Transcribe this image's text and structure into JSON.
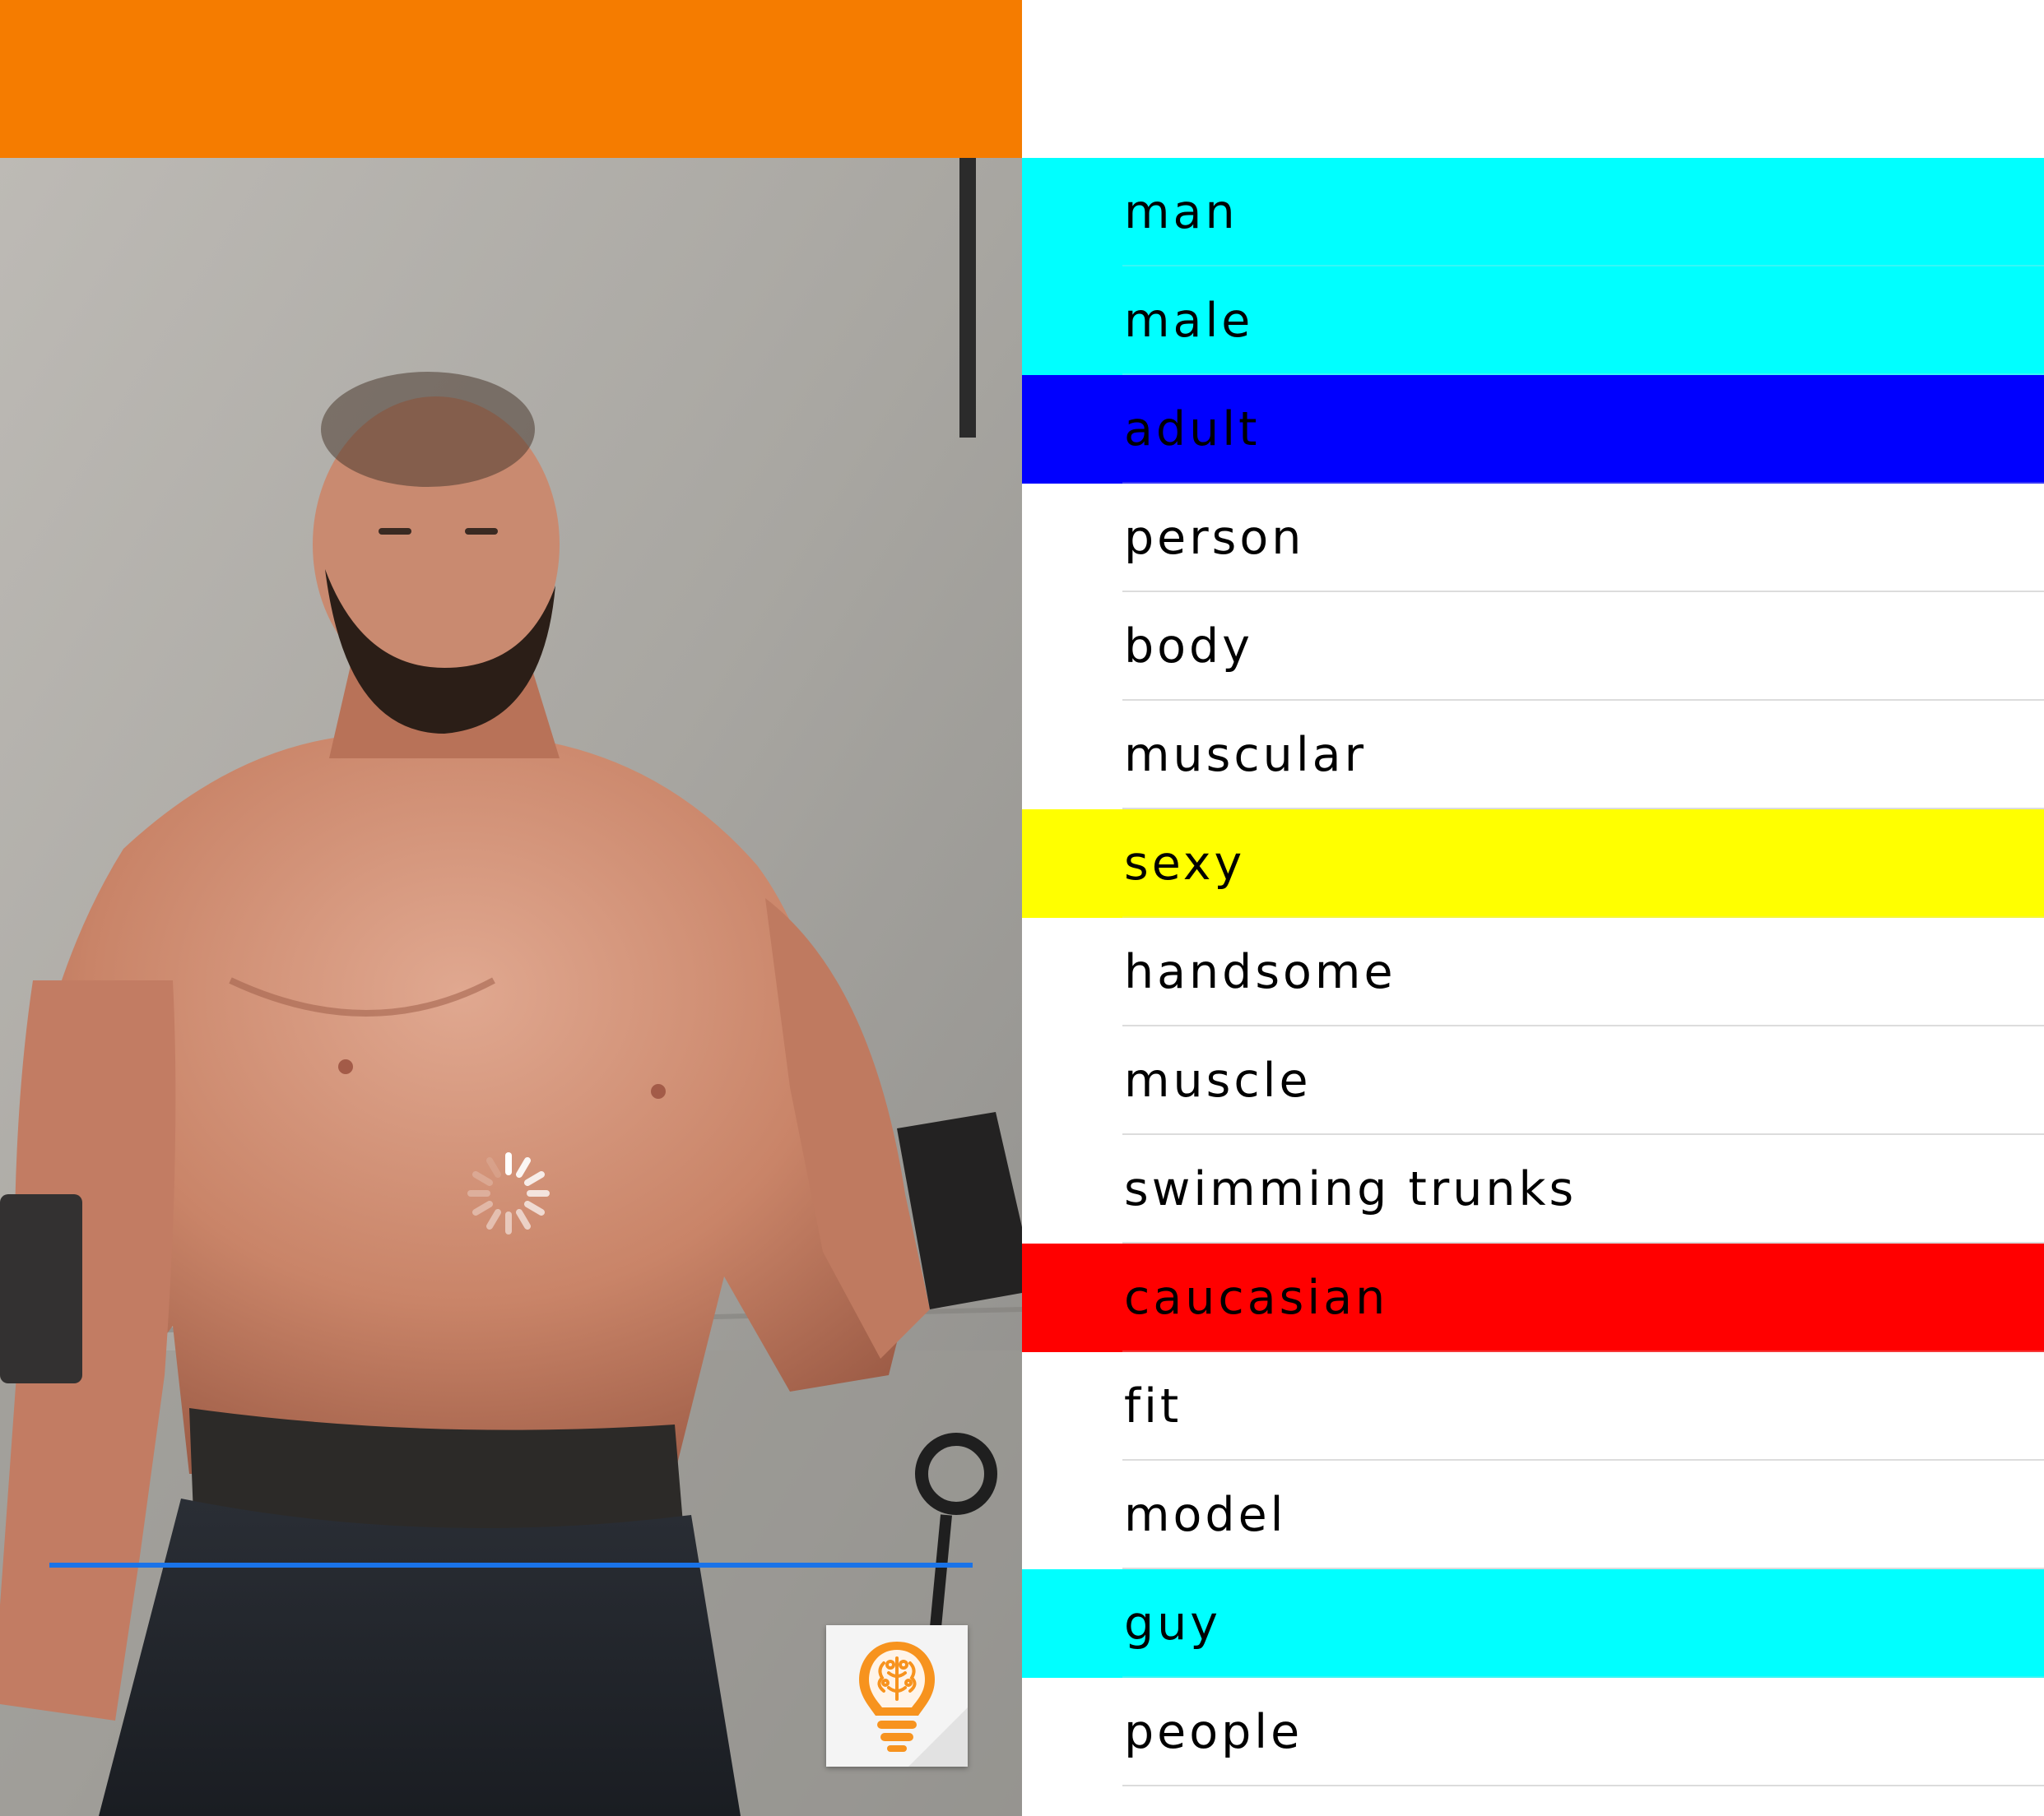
{
  "colors": {
    "top_bar": "#f57c00",
    "progress_line": "#1a73e8",
    "bulb_icon": "#f7931e",
    "divider": "#dcdcdc"
  },
  "top_bar": {
    "accent": "#f57c00"
  },
  "photo": {
    "loading_icon": "spinner-icon",
    "action_icon": "lightbulb-brain-icon"
  },
  "tags": [
    {
      "label": "man",
      "highlight": "#00ffff"
    },
    {
      "label": "male",
      "highlight": "#00ffff"
    },
    {
      "label": "adult",
      "highlight": "#0000ff"
    },
    {
      "label": "person",
      "highlight": null
    },
    {
      "label": "body",
      "highlight": null
    },
    {
      "label": "muscular",
      "highlight": null
    },
    {
      "label": "sexy",
      "highlight": "#ffff00"
    },
    {
      "label": "handsome",
      "highlight": null
    },
    {
      "label": "muscle",
      "highlight": null
    },
    {
      "label": "swimming trunks",
      "highlight": null
    },
    {
      "label": "caucasian",
      "highlight": "#ff0000"
    },
    {
      "label": "fit",
      "highlight": null
    },
    {
      "label": "model",
      "highlight": null
    },
    {
      "label": "guy",
      "highlight": "#00ffff"
    },
    {
      "label": "people",
      "highlight": null
    }
  ]
}
